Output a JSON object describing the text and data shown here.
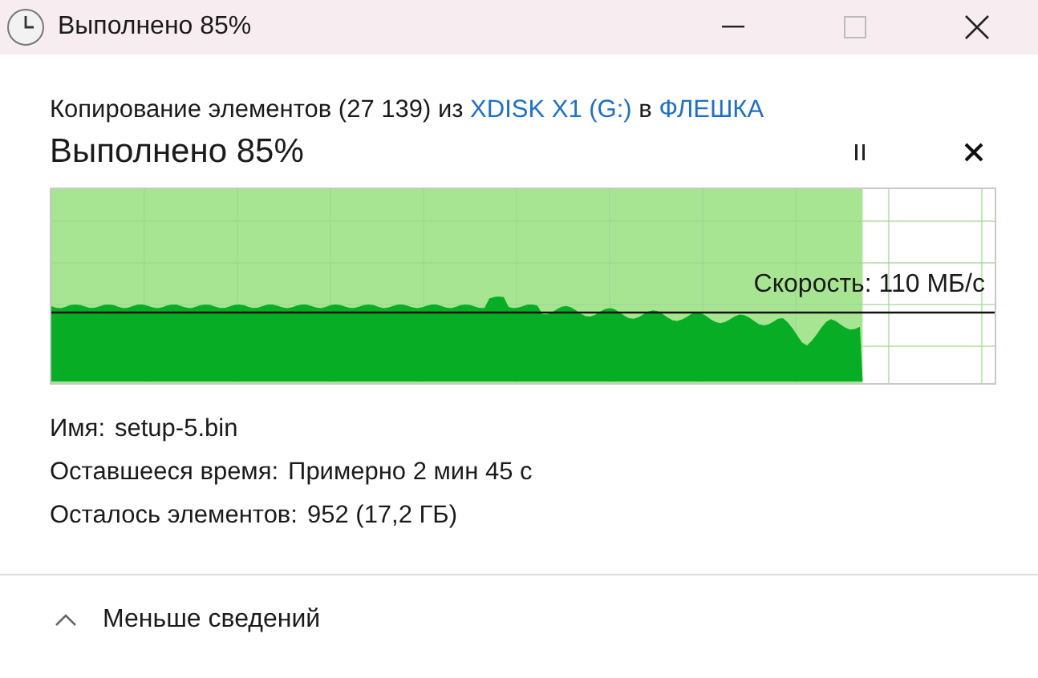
{
  "window": {
    "title": "Выполнено 85%"
  },
  "header": {
    "prefix": "Копирование элементов (27 139) из",
    "source": "XDISK X1 (G:)",
    "joiner": "в",
    "destination": "ФЛЕШКА"
  },
  "status": {
    "title": "Выполнено 85%",
    "paused": false
  },
  "progress": {
    "level": 0.86,
    "speed": "Скорость: 110 МБ/с"
  },
  "details": [
    {
      "label": "Имя:",
      "value": "setup-5.bin"
    },
    {
      "label": "Оставшееся время:",
      "value": "Примерно 2 мин 45 с"
    },
    {
      "label": "Осталось элементов:",
      "value": "952 (17,2 ГБ)"
    }
  ],
  "footer": {
    "label": "Меньше сведений",
    "expanded": true
  }
}
